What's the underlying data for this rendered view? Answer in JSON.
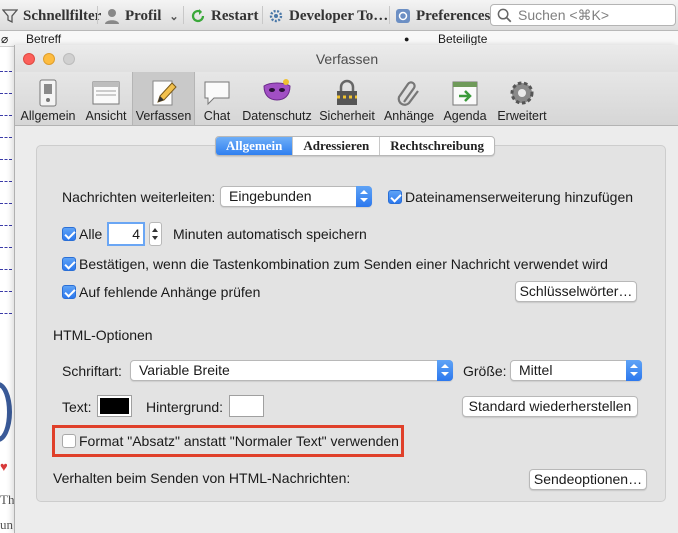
{
  "background": {
    "toolbar": {
      "quickfilter": "Schnellfilter",
      "profile": "Profil",
      "restart": "Restart",
      "developer": "Developer To…",
      "preferences": "Preferences",
      "search_placeholder": "Suchen <⌘K>"
    },
    "columns": {
      "subject": "Betreff",
      "dot": "●",
      "participants": "Beteiligte"
    },
    "edge_text": {
      "line1": "Th",
      "line2": "un"
    }
  },
  "dialog": {
    "title": "Verfassen",
    "panes": [
      {
        "label": "Allgemein",
        "icon": "switch-icon"
      },
      {
        "label": "Ansicht",
        "icon": "window-icon"
      },
      {
        "label": "Verfassen",
        "icon": "pencil-icon"
      },
      {
        "label": "Chat",
        "icon": "chat-bubble-icon"
      },
      {
        "label": "Datenschutz",
        "icon": "mask-icon"
      },
      {
        "label": "Sicherheit",
        "icon": "padlock-icon"
      },
      {
        "label": "Anhänge",
        "icon": "paperclip-icon"
      },
      {
        "label": "Agenda",
        "icon": "calendar-icon"
      },
      {
        "label": "Erweitert",
        "icon": "gear-icon"
      }
    ],
    "tabs": [
      "Allgemein",
      "Adressieren",
      "Rechtschreibung"
    ],
    "general": {
      "forward_label": "Nachrichten weiterleiten:",
      "forward_value": "Eingebunden",
      "add_extension_label": "Dateinamenserweiterung hinzufügen",
      "autosave_all_label": "Alle",
      "autosave_minutes": "4",
      "autosave_suffix": "Minuten automatisch speichern",
      "confirm_send_label": "Bestätigen, wenn die Tastenkombination zum Senden einer Nachricht verwendet wird",
      "missing_attachments_label": "Auf fehlende Anhänge prüfen",
      "keywords_button": "Schlüsselwörter…",
      "html_section_title": "HTML-Optionen",
      "font_label": "Schriftart:",
      "font_value": "Variable Breite",
      "size_label": "Größe:",
      "size_value": "Mittel",
      "text_color_label": "Text:",
      "text_color": "#000000",
      "bg_color_label": "Hintergrund:",
      "bg_color": "#ffffff",
      "restore_button": "Standard wiederherstellen",
      "paragraph_format_label": "Format \"Absatz\" anstatt \"Normaler Text\" verwenden",
      "html_send_label": "Verhalten beim Senden von HTML-Nachrichten:",
      "send_options_button": "Sendeoptionen…"
    }
  },
  "colors": {
    "accent": "#2f7ff0",
    "highlight": "#e0402a"
  }
}
